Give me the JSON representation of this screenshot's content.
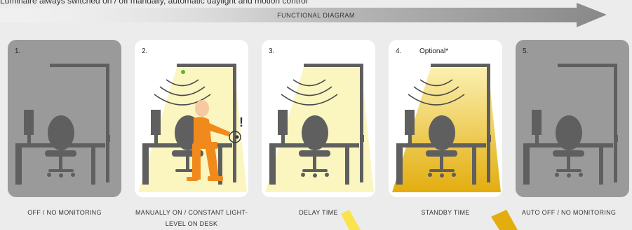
{
  "caption": "Luminaire always switched on / off manually, automatic daylight and motion control",
  "diagram_title": "FUNCTIONAL DIAGRAM",
  "stages": [
    {
      "number": "1.",
      "optional": "",
      "label": "OFF / NO MONITORING",
      "state": "off"
    },
    {
      "number": "2.",
      "optional": "",
      "label": "MANUALLY ON / CONSTANT LIGHT-LEVEL ON DESK",
      "state": "manual-on"
    },
    {
      "number": "3.",
      "optional": "",
      "label": "DELAY TIME",
      "state": "delay"
    },
    {
      "number": "4.",
      "optional": "Optional*",
      "label": "STANDBY TIME",
      "state": "standby"
    },
    {
      "number": "5.",
      "optional": "",
      "label": "AUTO OFF / NO MONITORING",
      "state": "auto-off"
    }
  ],
  "annotations": {
    "alert_mark": "!"
  },
  "colors": {
    "panel_off": "#9a9a9a",
    "panel_on": "#ffffff",
    "furniture": "#5f5f5f",
    "light_pale": "#fbf5c0",
    "light_gold": "#e3ad0e",
    "person": "#f08a1c",
    "sensor_dot": "#5cb52e",
    "arrow": "#8c8c8c"
  }
}
